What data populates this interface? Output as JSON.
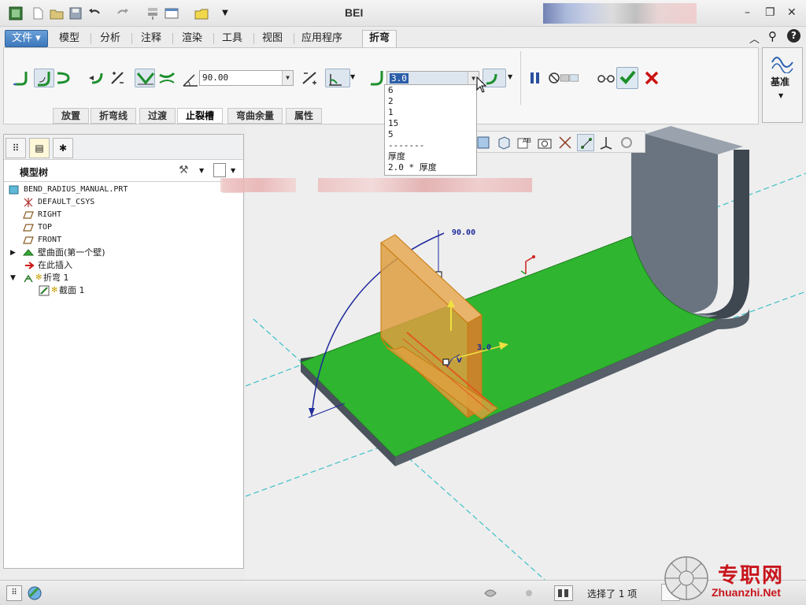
{
  "window": {
    "title": "BEI",
    "controls": [
      "–",
      "❐",
      "✕"
    ]
  },
  "menu": {
    "file": "文件",
    "tabs": [
      "模型",
      "分析",
      "注释",
      "渲染",
      "工具",
      "视图",
      "应用程序"
    ],
    "active_tab": "折弯",
    "help_icons": [
      "︿",
      "⚲",
      "?"
    ]
  },
  "ribbon": {
    "angle_value": "90.00",
    "radius_value": "3.0",
    "subtabs": [
      "放置",
      "折弯线",
      "过渡",
      "止裂槽",
      "弯曲余量",
      "属性"
    ],
    "active_subtab": "止裂槽",
    "datum_label": "基准"
  },
  "radius_dropdown": {
    "options": [
      "6",
      "2",
      "1",
      "15",
      "5",
      "-------",
      "厚度",
      "2.0 * 厚度"
    ]
  },
  "model_tree": {
    "header": "模型树",
    "items": [
      {
        "label": "BEND_RADIUS_MANUAL.PRT",
        "mono": true
      },
      {
        "label": "DEFAULT_CSYS",
        "mono": true
      },
      {
        "label": "RIGHT",
        "mono": true
      },
      {
        "label": "TOP",
        "mono": true
      },
      {
        "label": "FRONT",
        "mono": true
      },
      {
        "label": "壁曲面(第一个壁)",
        "mono": false
      },
      {
        "label": "在此插入",
        "mono": false
      },
      {
        "label": "折弯 1",
        "mono": false
      },
      {
        "label": "截面 1",
        "mono": false
      }
    ]
  },
  "viewport": {
    "angle_annotation": "90.00",
    "radius_annotation": "3.0",
    "v_label": "V"
  },
  "status": {
    "selection_text": "选择了 1 项"
  },
  "watermark": {
    "name": "专职网",
    "url": "Zhuanzhi.Net"
  },
  "colors": {
    "accent": "#3d78bc",
    "plate_green": "#2fb52f",
    "preview_orange": "#e0a040",
    "confirm_green": "#1d8f2a",
    "cancel_red": "#cc1111"
  }
}
